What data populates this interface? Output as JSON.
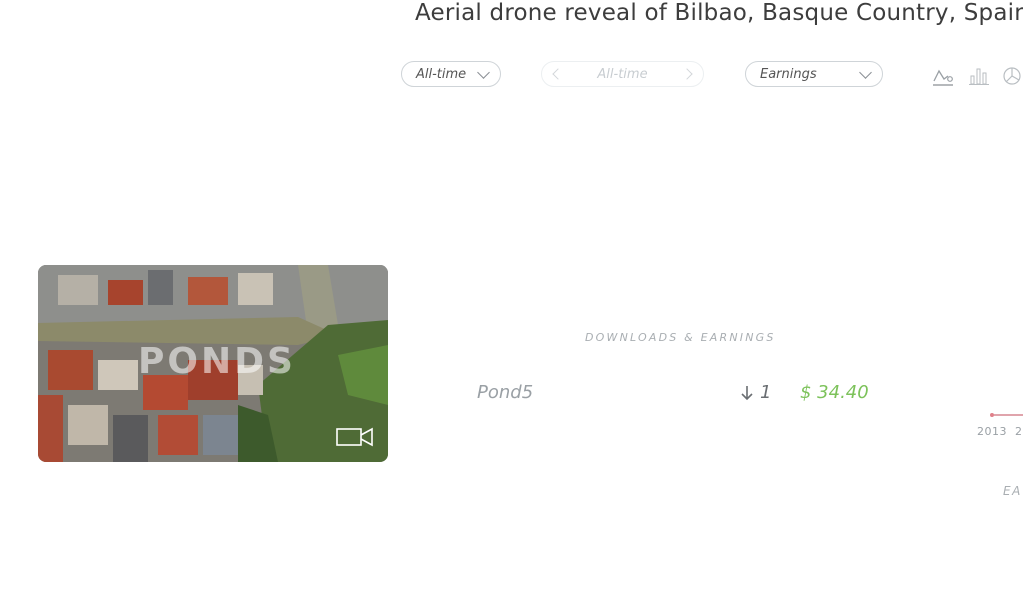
{
  "title": "Aerial drone reveal of Bilbao, Basque Country, Spain",
  "filters": {
    "period": "All-time",
    "period_nav": "All-time",
    "metric": "Earnings"
  },
  "chart_icons": [
    "line-chart-icon",
    "bar-chart-icon",
    "pie-chart-icon"
  ],
  "thumbnail": {
    "watermark": "PONDS",
    "media_type": "video-camera-icon"
  },
  "stats": {
    "section_label": "DOWNLOADS & EARNINGS",
    "rows": [
      {
        "agency": "Pond5",
        "downloads": "1",
        "earnings": "$ 34.40"
      }
    ]
  },
  "timeline": {
    "ticks": [
      "2013",
      "2"
    ],
    "label": "EA"
  },
  "colors": {
    "earnings": "#7cc25a",
    "timeline_dot": "#e0808a",
    "border": "#cfd4d8"
  }
}
